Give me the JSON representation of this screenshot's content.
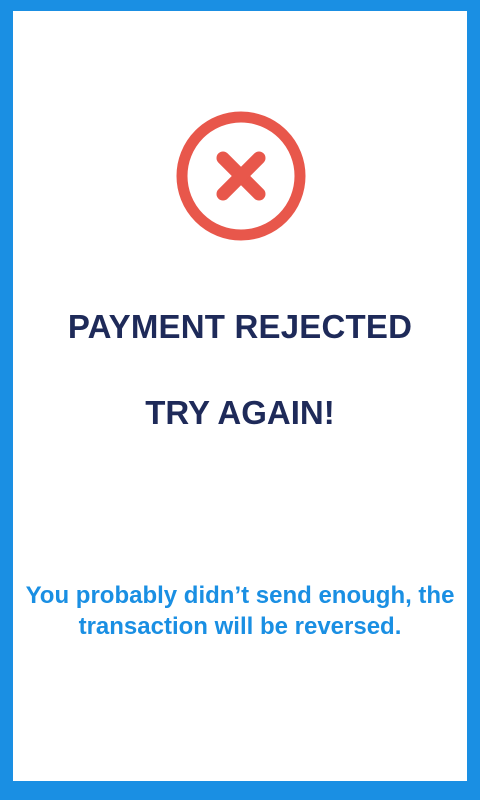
{
  "payment_status": {
    "icon": "error-x-circle-icon",
    "icon_color": "#e8574b",
    "title": "PAYMENT REJECTED",
    "subtitle": "TRY AGAIN!",
    "message": "You probably didn’t send enough, the transaction will be reversed."
  },
  "colors": {
    "border": "#1a8fe3",
    "heading": "#1e2a59",
    "message": "#1a8fe3",
    "background": "#ffffff"
  }
}
